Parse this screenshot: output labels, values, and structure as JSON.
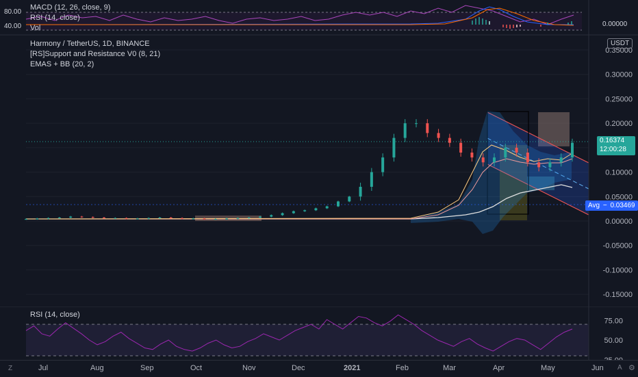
{
  "colors": {
    "background": "#131722",
    "grid": "#1e222d",
    "candle_up": "#26a69a",
    "candle_down": "#ef5350",
    "rsi": "#9c27b0",
    "channel": "#2962ff",
    "price_tag": "#26a69a",
    "avg_tag": "#2962ff"
  },
  "top_pane": {
    "scale_top": "80.00",
    "scale_bottom": "40.00",
    "right_value": "0.00000",
    "legend": {
      "macd": "MACD (12, 26, close, 9)",
      "rsi": "RSI (14, close)",
      "vol": "Vol"
    }
  },
  "main_pane": {
    "currency": "USDT",
    "title": "Harmony / TetherUS, 1D, BINANCE",
    "indicator_1": "[RS]Support and Resistance V0 (8, 21)",
    "indicator_2": "EMAS + BB (20, 2)",
    "price_ticks": [
      "0.35000",
      "0.30000",
      "0.25000",
      "0.20000",
      "0.15000",
      "0.10000",
      "0.05000",
      "0.00000",
      "-0.05000",
      "-0.10000",
      "-0.15000"
    ],
    "last_price": "0.16374",
    "countdown": "12:00:28",
    "avg_label": "Avg",
    "avg_value": "0.03469"
  },
  "rsi_pane": {
    "legend": "RSI (14, close)",
    "ticks": [
      "75.00",
      "50.00",
      "25.00"
    ]
  },
  "time_axis": {
    "labels": [
      "Jul",
      "Aug",
      "Sep",
      "Oct",
      "Nov",
      "Dec",
      "2021",
      "Feb",
      "Mar",
      "Apr",
      "May",
      "Jun"
    ]
  },
  "chart_data": {
    "type": "line",
    "title": "Harmony / TetherUS, 1D, BINANCE",
    "xlabel": "",
    "ylabel": "",
    "y_unit": "USDT",
    "ylim": [
      -0.17,
      0.36
    ],
    "x_labels": [
      "Jul",
      "Aug",
      "Sep",
      "Oct",
      "Nov",
      "Dec",
      "2021",
      "Feb",
      "Mar",
      "Apr",
      "May",
      "Jun"
    ],
    "series": [
      {
        "values": [
          0.004,
          0.005,
          0.006,
          0.007,
          0.009,
          0.008,
          0.007,
          0.006,
          0.006,
          0.005,
          0.005,
          0.006,
          0.007,
          0.006,
          0.005,
          0.005,
          0.004,
          0.004,
          0.005,
          0.006,
          0.007,
          0.009,
          0.012,
          0.016,
          0.02,
          0.022,
          0.026,
          0.03,
          0.04,
          0.05,
          0.07,
          0.1,
          0.13,
          0.17,
          0.2,
          0.2,
          0.18,
          0.17,
          0.16,
          0.14,
          0.13,
          0.12,
          0.13,
          0.15,
          0.14,
          0.12,
          0.11,
          0.12,
          0.13,
          0.16
        ]
      }
    ],
    "last_value": 0.16374,
    "avg_line": 0.03469,
    "rsi": {
      "levels": [
        70,
        30
      ],
      "values": [
        62,
        68,
        58,
        55,
        64,
        72,
        65,
        58,
        50,
        44,
        48,
        55,
        60,
        52,
        46,
        40,
        38,
        45,
        50,
        42,
        38,
        36,
        40,
        46,
        50,
        44,
        40,
        42,
        48,
        52,
        58,
        54,
        50,
        56,
        62,
        66,
        70,
        64,
        76,
        70,
        64,
        72,
        80,
        78,
        72,
        68,
        74,
        82,
        76,
        70,
        62,
        56,
        50,
        46,
        42,
        48,
        52,
        45,
        40,
        36,
        42,
        48,
        52,
        50,
        44,
        38,
        46,
        54,
        60,
        64
      ]
    }
  }
}
